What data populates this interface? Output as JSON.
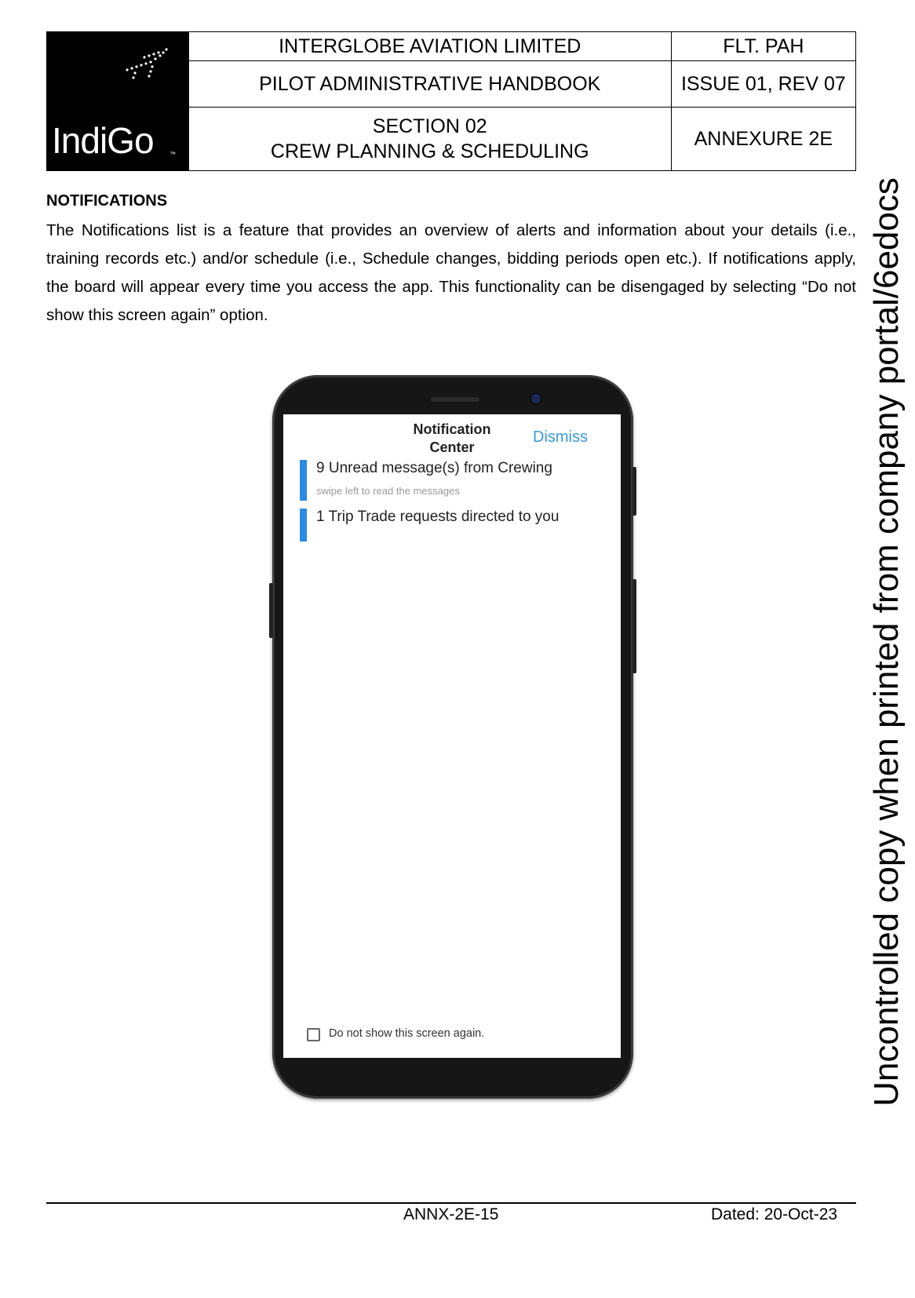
{
  "header": {
    "logo_text": "IndiGo",
    "company": "INTERGLOBE AVIATION LIMITED",
    "doc_code": "FLT. PAH",
    "handbook": "PILOT ADMINISTRATIVE HANDBOOK",
    "issue": "ISSUE 01, REV 07",
    "section_line1": "SECTION 02",
    "section_line2": "CREW PLANNING & SCHEDULING",
    "annexure": "ANNEXURE 2E"
  },
  "body": {
    "heading": "NOTIFICATIONS",
    "paragraph": "The Notifications list is a feature that provides an overview of alerts and information about your details (i.e., training records etc.) and/or schedule (i.e., Schedule changes, bidding periods open etc.). If notifications apply, the board will appear every time you access the app. This functionality can be disengaged by selecting “Do not show this screen again” option."
  },
  "phone_screen": {
    "title_line1": "Notification",
    "title_line2": "Center",
    "dismiss_label": "Dismiss",
    "notifications": [
      {
        "text": "9 Unread message(s) from Crewing",
        "subtext": "swipe left to read the messages"
      },
      {
        "text": "1 Trip Trade requests directed to you"
      }
    ],
    "checkbox_label": "Do not show this screen again.",
    "checkbox_checked": false,
    "accent_color": "#2e8ae0"
  },
  "footer": {
    "page_id": "ANNX-2E-15",
    "dated": "Dated: 20-Oct-23"
  },
  "watermark": "Uncontrolled copy when printed from company portal/6edocs"
}
